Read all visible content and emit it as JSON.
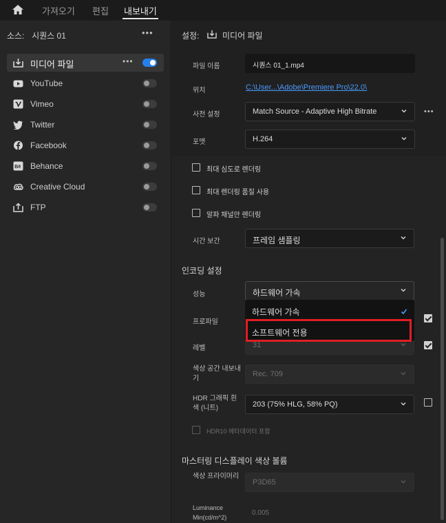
{
  "topbar": {
    "tabs": [
      {
        "label": "가져오기"
      },
      {
        "label": "편집"
      },
      {
        "label": "내보내기"
      }
    ]
  },
  "source": {
    "label": "소스:",
    "value": "시퀀스 01",
    "more": "•••"
  },
  "destinations": [
    {
      "label": "미디어 파일",
      "icon": "download-icon",
      "enabled": true
    },
    {
      "label": "YouTube",
      "icon": "youtube-icon",
      "enabled": false
    },
    {
      "label": "Vimeo",
      "icon": "vimeo-icon",
      "enabled": false
    },
    {
      "label": "Twitter",
      "icon": "twitter-icon",
      "enabled": false
    },
    {
      "label": "Facebook",
      "icon": "facebook-icon",
      "enabled": false
    },
    {
      "label": "Behance",
      "icon": "behance-icon",
      "enabled": false
    },
    {
      "label": "Creative Cloud",
      "icon": "creative-cloud-icon",
      "enabled": false
    },
    {
      "label": "FTP",
      "icon": "upload-icon",
      "enabled": false
    }
  ],
  "settings": {
    "header_label": "설정:",
    "header_value": "미디어 파일",
    "filename_label": "파일 이름",
    "filename_value": "시퀀스 01_1.mp4",
    "location_label": "위치",
    "location_value": "C:\\User...\\Adobe\\Premiere Pro\\22.0\\",
    "preset_label": "사전 설정",
    "preset_value": "Match Source - Adaptive High Bitrate",
    "format_label": "포맷",
    "format_value": "H.264",
    "more": "•••"
  },
  "render_options": [
    {
      "label": "최대 심도로 렌더링"
    },
    {
      "label": "최대 렌더링 품질 사용"
    },
    {
      "label": "알파 채널만 렌더링"
    }
  ],
  "time_interp": {
    "label": "시간 보간",
    "value": "프레임 샘플링"
  },
  "encoding": {
    "header": "인코딩 설정",
    "performance_label": "성능",
    "performance_value": "하드웨어 가속",
    "profile_label": "프로파일",
    "level_label": "레벨",
    "level_value": "31",
    "color_space_label": "색상 공간 내보내기",
    "color_space_value": "Rec. 709",
    "hdr_label": "HDR 그래픽 흰색 (니트)",
    "hdr_value": "203 (75% HLG, 58% PQ)",
    "hdr10_label": "HDR10 메타데이터 포함"
  },
  "dropdown": {
    "options": [
      {
        "label": "하드웨어 가속",
        "selected": true
      },
      {
        "label": "소프트웨어 전용",
        "selected": false
      }
    ]
  },
  "mastering": {
    "header": "마스터링 디스플레이 색상 볼륨",
    "primaries_label": "색상 프라이머리",
    "primaries_value": "P3D65",
    "lum_label": "Luminance Min(cd/m^2)",
    "lum_value": "0.005"
  },
  "colors": {
    "accent": "#2680eb",
    "highlight_box": "#e01e24",
    "link": "#4a9bff"
  }
}
